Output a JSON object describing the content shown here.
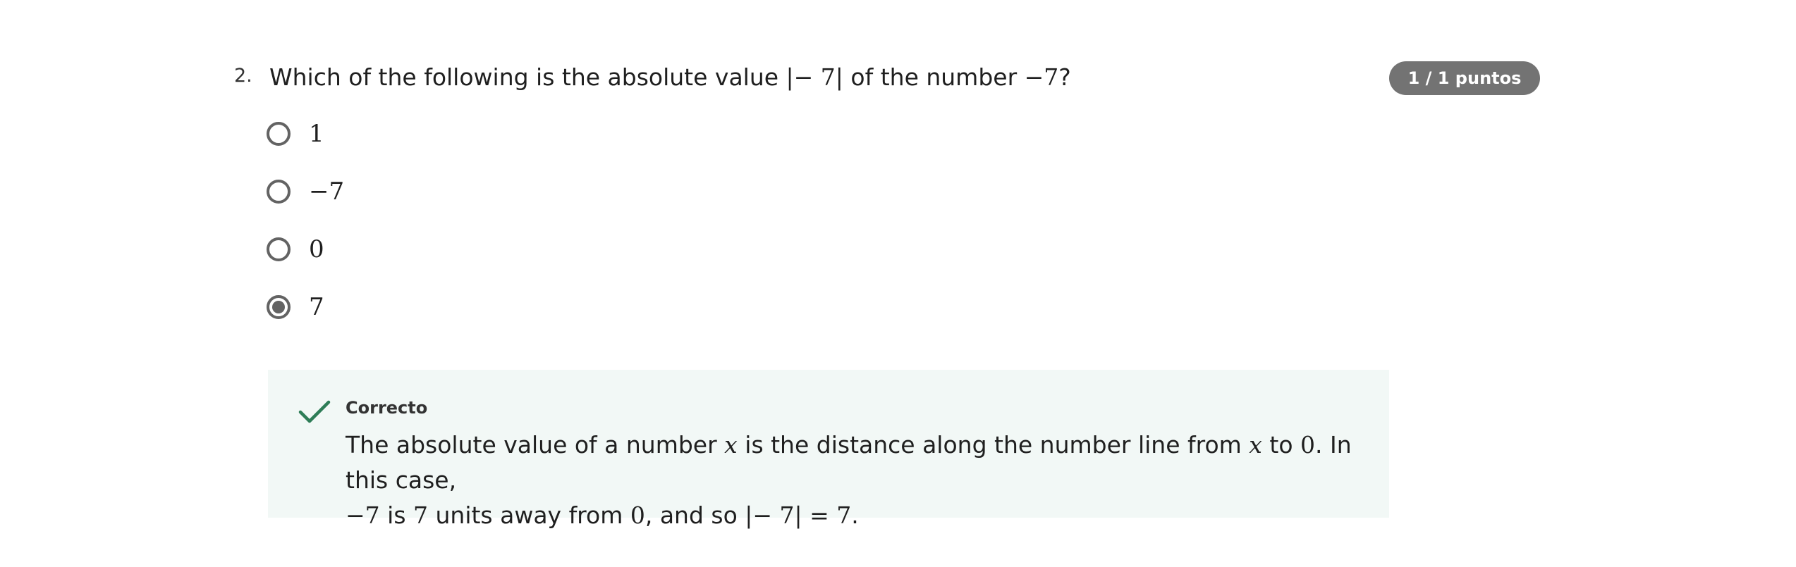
{
  "question": {
    "number": "2.",
    "text_before": "Which of the following is the absolute value ",
    "math_abs": "|− 7|",
    "text_middle": " of the number ",
    "math_neg": "−7",
    "text_after": "?",
    "score": "1 / 1 puntos"
  },
  "options": [
    {
      "label": "1",
      "selected": false
    },
    {
      "label": "−7",
      "selected": false
    },
    {
      "label": "0",
      "selected": false
    },
    {
      "label": "7",
      "selected": true
    }
  ],
  "feedback": {
    "status": "Correcto",
    "icon": "check-icon",
    "color": "#2e7d57",
    "p1": "The absolute value of a number ",
    "m_x1": "x",
    "p2": " is the distance along the number line from ",
    "m_x2": "x",
    "p3": " to ",
    "m_zero1": "0",
    "p4": ". In this case,",
    "m_neg7": "−7",
    "p5": " is ",
    "m_seven": "7",
    "p6": " units away from ",
    "m_zero2": "0",
    "p7": ", and so ",
    "m_eq": "|− 7| = 7",
    "p8": "."
  },
  "colors": {
    "badge_bg": "#737373",
    "feedback_bg": "#f2f8f6",
    "radio": "#636363"
  }
}
